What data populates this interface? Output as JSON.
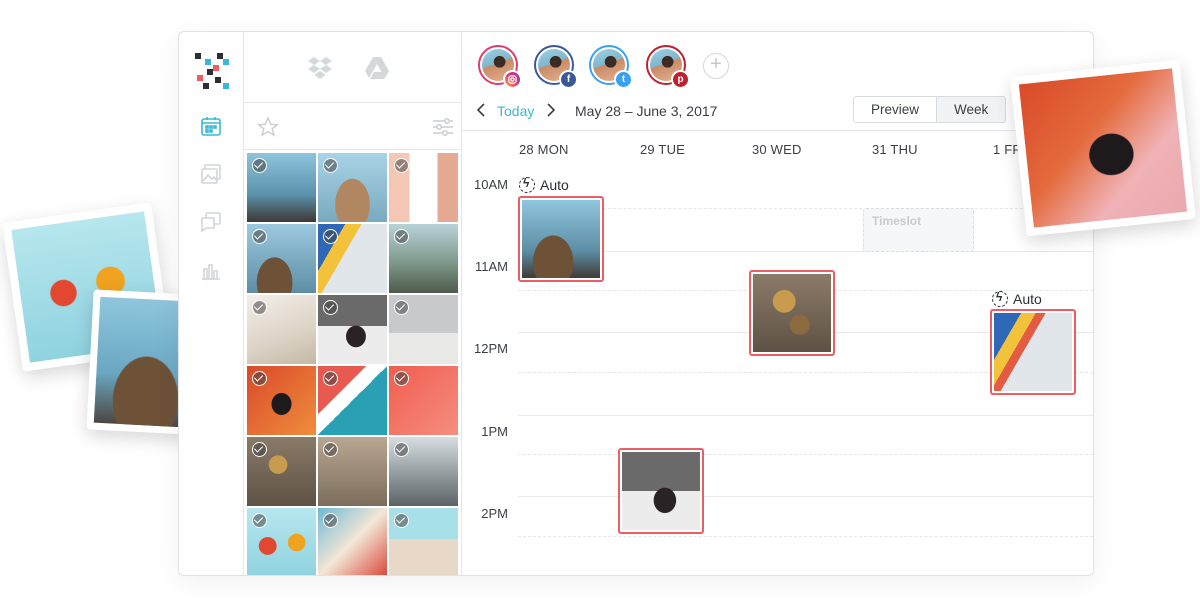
{
  "media": {
    "sources": [
      {
        "icon": "dropbox-icon"
      },
      {
        "icon": "google-drive-icon"
      }
    ],
    "tools": [
      {
        "icon": "star-icon"
      },
      {
        "icon": "sliders-icon"
      }
    ]
  },
  "nav": {
    "logo": "app-logo",
    "items": [
      {
        "icon": "calendar-icon",
        "active": true,
        "color": "#39b8d5"
      },
      {
        "icon": "gallery-icon",
        "active": false,
        "color": "#d2d6da"
      },
      {
        "icon": "chat-icon",
        "active": false,
        "color": "#d2d6da"
      },
      {
        "icon": "bar-chart-icon",
        "active": false,
        "color": "#d2d6da"
      }
    ]
  },
  "profiles": [
    {
      "network": "instagram",
      "badge": "",
      "color": "#dd3c6f"
    },
    {
      "network": "facebook",
      "badge": "f",
      "color": "#3b5998"
    },
    {
      "network": "twitter",
      "badge": "t",
      "color": "#38a1f3"
    },
    {
      "network": "pinterest",
      "badge": "p",
      "color": "#bd2130"
    }
  ],
  "add_profile": "+",
  "calendar": {
    "today_label": "Today",
    "date_range": "May 28 – June 3, 2017",
    "view_buttons": [
      "Preview",
      "Week"
    ],
    "active_view": "Week",
    "days": [
      "28 MON",
      "29 TUE",
      "30 WED",
      "31 THU",
      "1 FRI"
    ],
    "times": [
      "10AM",
      "11AM",
      "12PM",
      "1PM",
      "2PM"
    ],
    "auto_label": "Auto",
    "timeslot_label": "Timeslot"
  },
  "colors": {
    "accent": "#39b8d5",
    "post_border": "#ec5e63"
  }
}
